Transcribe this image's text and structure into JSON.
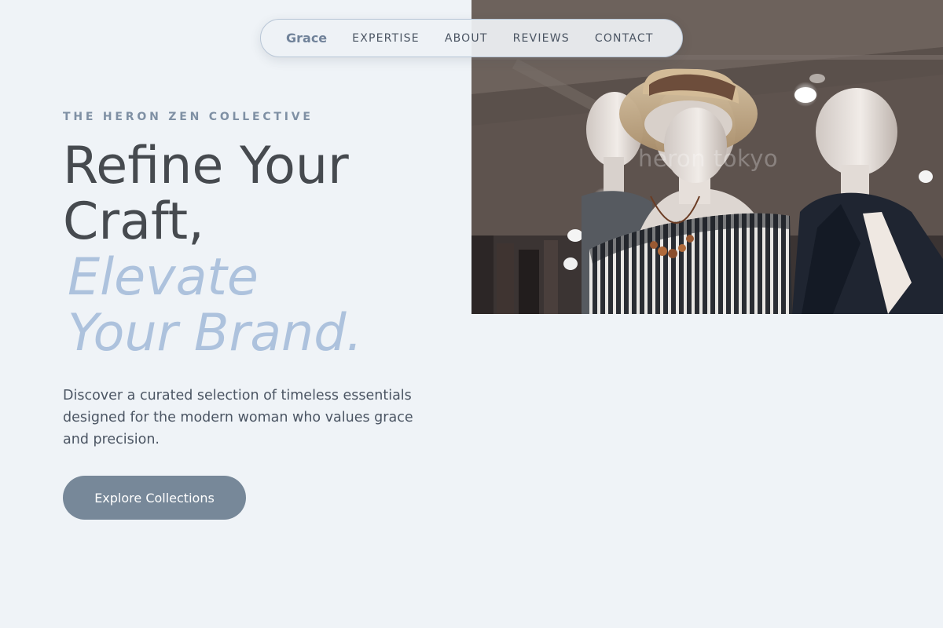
{
  "nav": {
    "brand": "Grace",
    "links": [
      "EXPERTISE",
      "ABOUT",
      "REVIEWS",
      "CONTACT"
    ]
  },
  "hero": {
    "eyebrow": "THE HERON ZEN COLLECTIVE",
    "headline_line1": "Refine Your",
    "headline_line2": "Craft,",
    "headline_accent_line1": "Elevate",
    "headline_accent_line2": "Your Brand.",
    "description": "Discover a curated selection of timeless essentials designed for the modern woman who values grace and precision.",
    "cta_label": "Explore Collections"
  },
  "image": {
    "watermark": "heron tokyo"
  },
  "colors": {
    "page_background": "#eff3f7",
    "headline": "#464a4f",
    "accent": "#adc2dd",
    "eyebrow": "#7f90a4",
    "brand": "#71839a",
    "button": "#778899"
  }
}
